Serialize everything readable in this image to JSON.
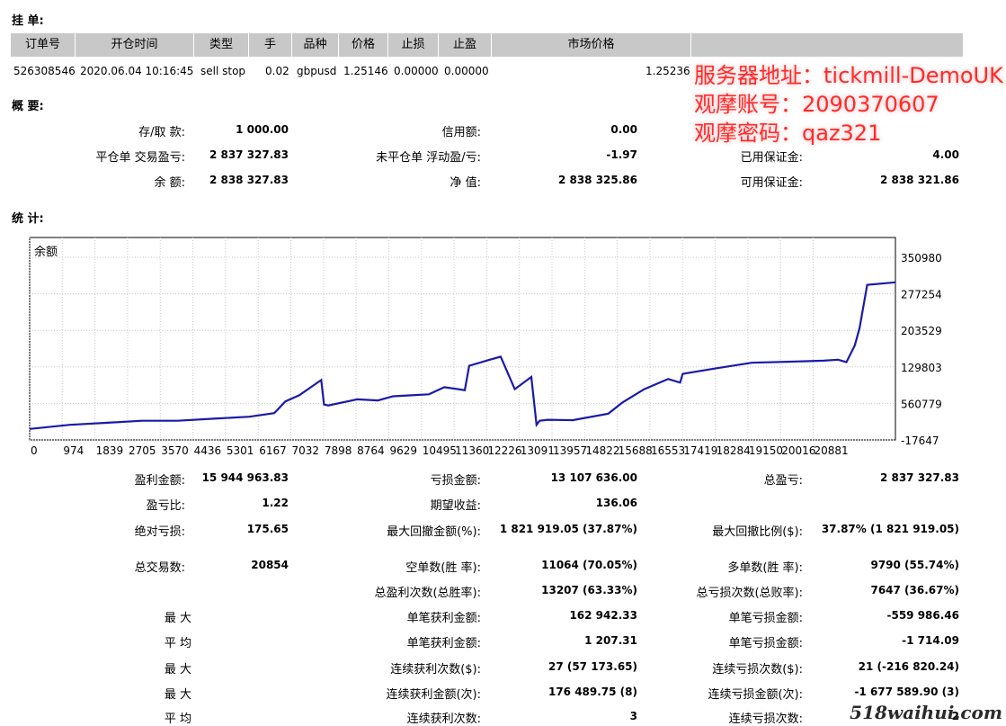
{
  "pending": {
    "title": "挂 单:",
    "columns": [
      "订单号",
      "开仓时间",
      "类型",
      "手",
      "品种",
      "价格",
      "止损",
      "止盈",
      "市场价格"
    ],
    "row": {
      "ticket": "526308546",
      "time": "2020.06.04 10:16:45",
      "type": "sell stop",
      "lots": "0.02",
      "symbol": "gbpusd",
      "price": "1.25146",
      "sl": "0.00000",
      "tp": "0.00000",
      "market": "1.25236"
    }
  },
  "summary": {
    "title": "概 要:",
    "deposit_label": "存/取 款:",
    "deposit_value": "1 000.00",
    "credit_label": "信用额:",
    "credit_value": "0.00",
    "closed_pl_label": "平仓单 交易盈亏:",
    "closed_pl_value": "2 837 327.83",
    "floating_label": "未平仓单 浮动盈/亏:",
    "floating_value": "-1.97",
    "margin_label": "已用保证金:",
    "margin_value": "4.00",
    "balance_label": "余 额:",
    "balance_value": "2 838 327.83",
    "equity_label": "净 值:",
    "equity_value": "2 838 325.86",
    "free_margin_label": "可用保证金:",
    "free_margin_value": "2 838 321.86"
  },
  "watermark": {
    "line1": "服务器地址：tickmill-DemoUK",
    "line2": "观摩账号：2090370607",
    "line3": "观摩密码：qaz321",
    "site": "518waihui.com",
    "color": "#ff2a2a"
  },
  "stats": {
    "title": "统 计:",
    "chart_label": "余额",
    "gross_profit_label": "盈利金额:",
    "gross_profit_value": "15 944 963.83",
    "gross_loss_label": "亏损金额:",
    "gross_loss_value": "13 107 636.00",
    "total_pl_label": "总盈亏:",
    "total_pl_value": "2 837 327.83",
    "profit_factor_label": "盈亏比:",
    "profit_factor_value": "1.22",
    "expected_label": "期望收益:",
    "expected_value": "136.06",
    "abs_dd_label": "绝对亏损:",
    "abs_dd_value": "175.65",
    "max_dd_label": "最大回撤金额(%):",
    "max_dd_value": "1 821 919.05 (37.87%)",
    "max_dd_rel_label": "最大回撤比例($):",
    "max_dd_rel_value": "37.87% (1 821 919.05)",
    "total_trades_label": "总交易数:",
    "total_trades_value": "20854",
    "short_label": "空单数(胜 率):",
    "short_value": "11064 (70.05%)",
    "long_label": "多单数(胜 率):",
    "long_value": "9790 (55.74%)",
    "win_label": "总盈利次数(总胜率):",
    "win_value": "13207 (63.33%)",
    "loss_label": "总亏损次数(总败率):",
    "loss_value": "7647 (36.67%)",
    "max1_label": "最 大",
    "largest_win_label": "单笔获利金额:",
    "largest_win_value": "162 942.33",
    "largest_loss_label": "单笔亏损金额:",
    "largest_loss_value": "-559 986.46",
    "avg1_label": "平 均",
    "avg_win_label": "单笔获利金额:",
    "avg_win_value": "1 207.31",
    "avg_loss_label": "单笔亏损金额:",
    "avg_loss_value": "-1 714.09",
    "max2_label": "最 大",
    "consec_wins_label": "连续获利次数($):",
    "consec_wins_value": "27 (57 173.65)",
    "consec_losses_label": "连续亏损次数($):",
    "consec_losses_value": "21 (-216 820.24)",
    "max3_label": "最 大",
    "consec_profit_label": "连续获利金额(次):",
    "consec_profit_value": "176 489.75 (8)",
    "consec_loss_amt_label": "连续亏损金额(次):",
    "consec_loss_amt_value": "-1 677 589.90 (3)",
    "avg2_label": "平 均",
    "avg_consec_wins_label": "连续获利次数:",
    "avg_consec_wins_value": "3",
    "avg_consec_losses_label": "连续亏损次数:",
    "avg_consec_losses_value": "2"
  },
  "chart_data": {
    "type": "line",
    "title": "余额",
    "line_color": "#1a1aa8",
    "grid": true,
    "y_ticks": [
      "350980",
      "277254",
      "203529",
      "129803",
      "560779",
      "-17647"
    ],
    "x_ticks": [
      "0",
      "974",
      "1839",
      "2705",
      "3570",
      "4436",
      "5301",
      "6167",
      "7032",
      "7898",
      "8764",
      "9629",
      "10495",
      "11360",
      "12226",
      "13091",
      "13957",
      "14822",
      "15688",
      "16553",
      "17419",
      "18284",
      "19150",
      "20016",
      "20881"
    ],
    "xlim": [
      0,
      20881
    ],
    "ylim": [
      -17647,
      380000
    ],
    "x": [
      0,
      974,
      1839,
      2705,
      3570,
      4436,
      5301,
      5900,
      6167,
      6500,
      7032,
      7100,
      7200,
      7898,
      8400,
      8764,
      9200,
      9629,
      10000,
      10495,
      10600,
      11100,
      11360,
      11700,
      12100,
      12226,
      12300,
      12500,
      13091,
      13957,
      14300,
      14822,
      15400,
      15688,
      15750,
      16553,
      17419,
      18284,
      19150,
      19500,
      19700,
      19900,
      20016,
      20200,
      20881
    ],
    "y": [
      4000,
      12000,
      16000,
      20000,
      20000,
      24000,
      28000,
      35000,
      58000,
      70000,
      100000,
      52000,
      50000,
      62000,
      60000,
      68000,
      70000,
      72000,
      86000,
      80000,
      128000,
      140000,
      146000,
      82000,
      106000,
      12000,
      20000,
      22000,
      21000,
      34000,
      56000,
      82000,
      102000,
      95000,
      112000,
      123000,
      134000,
      136000,
      138000,
      140000,
      135000,
      168000,
      202000,
      287000,
      292000
    ]
  }
}
